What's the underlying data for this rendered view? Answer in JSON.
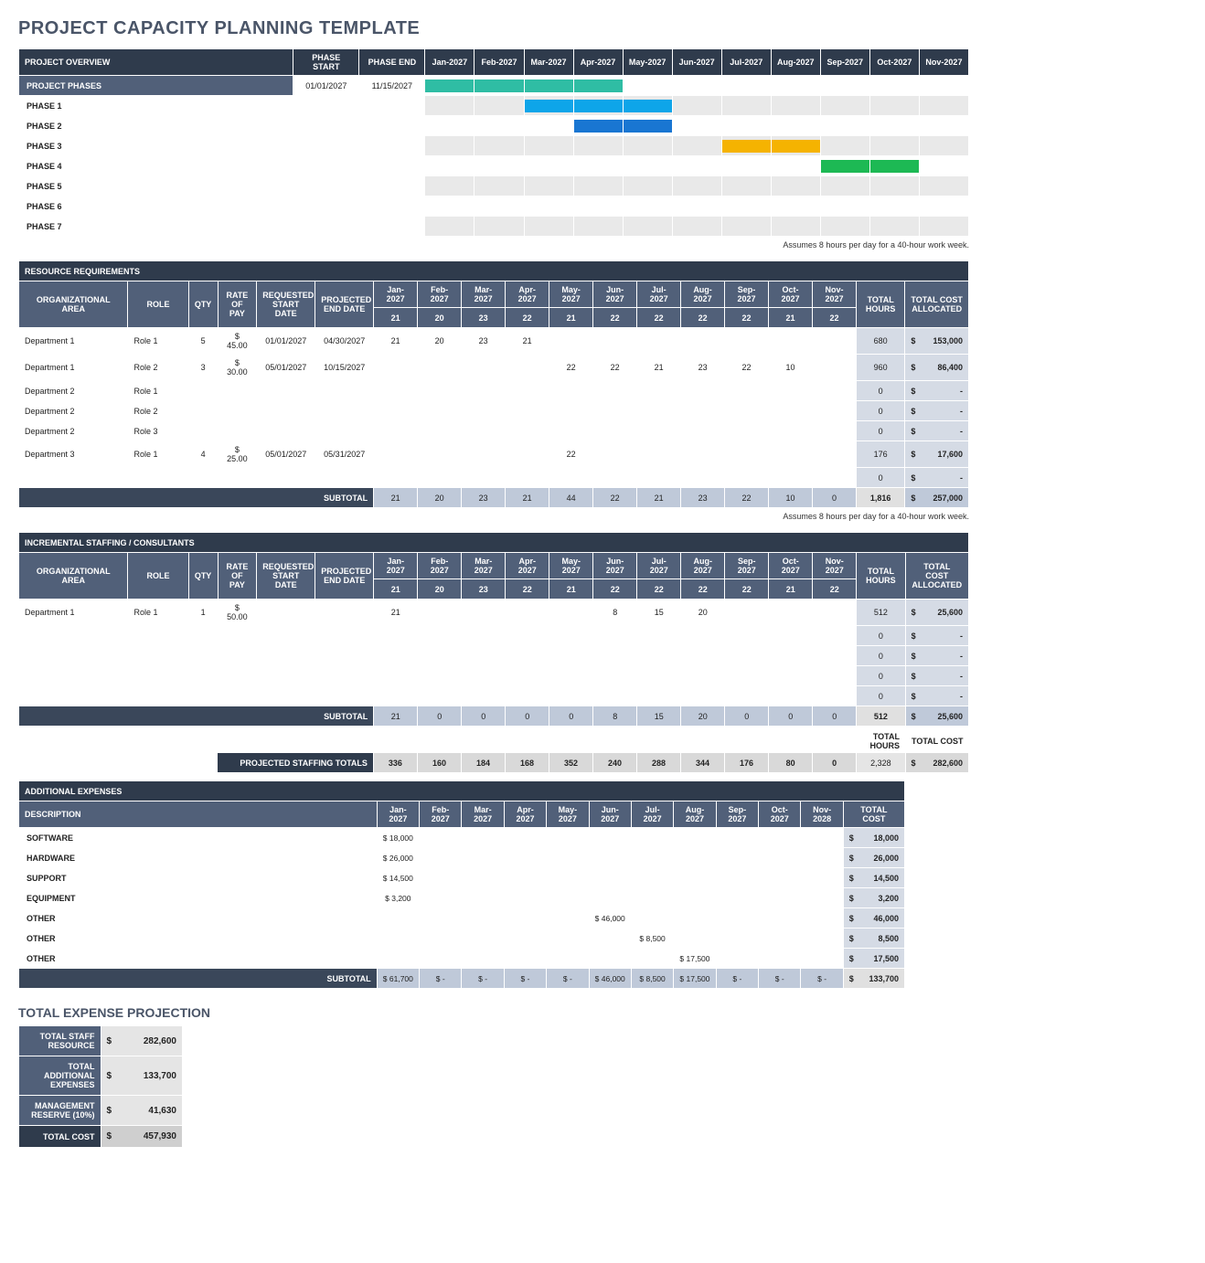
{
  "title": "PROJECT CAPACITY PLANNING TEMPLATE",
  "note": "Assumes 8 hours per day for a 40-hour work week.",
  "months": [
    "Jan-2027",
    "Feb-2027",
    "Mar-2027",
    "Apr-2027",
    "May-2027",
    "Jun-2027",
    "Jul-2027",
    "Aug-2027",
    "Sep-2027",
    "Oct-2027",
    "Nov-2027"
  ],
  "months_exp": [
    "Jan-2027",
    "Feb-2027",
    "Mar-2027",
    "Apr-2027",
    "May-2027",
    "Jun-2027",
    "Jul-2027",
    "Aug-2027",
    "Sep-2027",
    "Oct-2027",
    "Nov-2028"
  ],
  "overview": {
    "header": "PROJECT OVERVIEW",
    "phase_start": "PHASE START",
    "phase_end": "PHASE END",
    "rows": [
      {
        "label": "PROJECT PHASES",
        "start": "01/01/2027",
        "end": "11/15/2027",
        "fills": [
          "teal",
          "teal",
          "teal",
          "teal",
          "",
          "",
          "",
          "",
          "",
          "",
          ""
        ]
      },
      {
        "label": "PHASE 1",
        "start": "",
        "end": "",
        "fills": [
          "",
          "",
          "blue",
          "blue",
          "blue",
          "",
          "",
          "",
          "",
          "",
          ""
        ]
      },
      {
        "label": "PHASE 2",
        "start": "",
        "end": "",
        "fills": [
          "",
          "",
          "",
          "dblue",
          "dblue",
          "",
          "",
          "",
          "",
          "",
          ""
        ]
      },
      {
        "label": "PHASE 3",
        "start": "",
        "end": "",
        "fills": [
          "",
          "",
          "",
          "",
          "",
          "",
          "yellow",
          "yellow",
          "",
          "",
          ""
        ]
      },
      {
        "label": "PHASE 4",
        "start": "",
        "end": "",
        "fills": [
          "",
          "",
          "",
          "",
          "",
          "",
          "",
          "",
          "green",
          "green",
          ""
        ]
      },
      {
        "label": "PHASE 5",
        "start": "",
        "end": "",
        "fills": [
          "",
          "",
          "",
          "",
          "",
          "",
          "",
          "",
          "",
          "",
          ""
        ]
      },
      {
        "label": "PHASE 6",
        "start": "",
        "end": "",
        "fills": [
          "",
          "",
          "",
          "",
          "",
          "",
          "",
          "",
          "",
          "",
          ""
        ]
      },
      {
        "label": "PHASE 7",
        "start": "",
        "end": "",
        "fills": [
          "",
          "",
          "",
          "",
          "",
          "",
          "",
          "",
          "",
          "",
          ""
        ]
      }
    ]
  },
  "resource": {
    "header": "RESOURCE REQUIREMENTS",
    "cols": {
      "org": "ORGANIZATIONAL AREA",
      "role": "ROLE",
      "qty": "QTY",
      "rate": "RATE OF PAY",
      "req": "REQUESTED START DATE",
      "proj": "PROJECTED END DATE",
      "th": "TOTAL HOURS",
      "tc": "TOTAL COST ALLOCATED"
    },
    "month_sub": [
      "21",
      "20",
      "23",
      "22",
      "21",
      "22",
      "22",
      "22",
      "22",
      "21",
      "22"
    ],
    "rows": [
      {
        "org": "Department 1",
        "role": "Role 1",
        "qty": "5",
        "rate": "$ 45.00",
        "req": "01/01/2027",
        "proj": "04/30/2027",
        "m": [
          "21",
          "20",
          "23",
          "21",
          "",
          "",
          "",
          "",
          "",
          "",
          ""
        ],
        "th": "680",
        "tc": "153,000"
      },
      {
        "org": "Department 1",
        "role": "Role 2",
        "qty": "3",
        "rate": "$ 30.00",
        "req": "05/01/2027",
        "proj": "10/15/2027",
        "m": [
          "",
          "",
          "",
          "",
          "22",
          "22",
          "21",
          "23",
          "22",
          "10",
          ""
        ],
        "th": "960",
        "tc": "86,400"
      },
      {
        "org": "Department 2",
        "role": "Role 1",
        "qty": "",
        "rate": "",
        "req": "",
        "proj": "",
        "m": [
          "",
          "",
          "",
          "",
          "",
          "",
          "",
          "",
          "",
          "",
          ""
        ],
        "th": "0",
        "tc": "-"
      },
      {
        "org": "Department 2",
        "role": "Role 2",
        "qty": "",
        "rate": "",
        "req": "",
        "proj": "",
        "m": [
          "",
          "",
          "",
          "",
          "",
          "",
          "",
          "",
          "",
          "",
          ""
        ],
        "th": "0",
        "tc": "-"
      },
      {
        "org": "Department 2",
        "role": "Role 3",
        "qty": "",
        "rate": "",
        "req": "",
        "proj": "",
        "m": [
          "",
          "",
          "",
          "",
          "",
          "",
          "",
          "",
          "",
          "",
          ""
        ],
        "th": "0",
        "tc": "-"
      },
      {
        "org": "Department 3",
        "role": "Role 1",
        "qty": "4",
        "rate": "$ 25.00",
        "req": "05/01/2027",
        "proj": "05/31/2027",
        "m": [
          "",
          "",
          "",
          "",
          "22",
          "",
          "",
          "",
          "",
          "",
          ""
        ],
        "th": "176",
        "tc": "17,600"
      },
      {
        "org": "",
        "role": "",
        "qty": "",
        "rate": "",
        "req": "",
        "proj": "",
        "m": [
          "",
          "",
          "",
          "",
          "",
          "",
          "",
          "",
          "",
          "",
          ""
        ],
        "th": "0",
        "tc": "-"
      }
    ],
    "subtotal_label": "SUBTOTAL",
    "subtotal_m": [
      "21",
      "20",
      "23",
      "21",
      "44",
      "22",
      "21",
      "23",
      "22",
      "10",
      "0"
    ],
    "subtotal_th": "1,816",
    "subtotal_tc": "257,000"
  },
  "incremental": {
    "header": "INCREMENTAL STAFFING / CONSULTANTS",
    "month_sub": [
      "21",
      "20",
      "23",
      "22",
      "21",
      "22",
      "22",
      "22",
      "22",
      "21",
      "22"
    ],
    "rows": [
      {
        "org": "Department 1",
        "role": "Role 1",
        "qty": "1",
        "rate": "$ 50.00",
        "req": "",
        "proj": "",
        "m": [
          "21",
          "",
          "",
          "",
          "",
          "8",
          "15",
          "20",
          "",
          "",
          ""
        ],
        "th": "512",
        "tc": "25,600"
      },
      {
        "org": "",
        "role": "",
        "qty": "",
        "rate": "",
        "req": "",
        "proj": "",
        "m": [
          "",
          "",
          "",
          "",
          "",
          "",
          "",
          "",
          "",
          "",
          ""
        ],
        "th": "0",
        "tc": "-"
      },
      {
        "org": "",
        "role": "",
        "qty": "",
        "rate": "",
        "req": "",
        "proj": "",
        "m": [
          "",
          "",
          "",
          "",
          "",
          "",
          "",
          "",
          "",
          "",
          ""
        ],
        "th": "0",
        "tc": "-"
      },
      {
        "org": "",
        "role": "",
        "qty": "",
        "rate": "",
        "req": "",
        "proj": "",
        "m": [
          "",
          "",
          "",
          "",
          "",
          "",
          "",
          "",
          "",
          "",
          ""
        ],
        "th": "0",
        "tc": "-"
      },
      {
        "org": "",
        "role": "",
        "qty": "",
        "rate": "",
        "req": "",
        "proj": "",
        "m": [
          "",
          "",
          "",
          "",
          "",
          "",
          "",
          "",
          "",
          "",
          ""
        ],
        "th": "0",
        "tc": "-"
      }
    ],
    "subtotal_m": [
      "21",
      "0",
      "0",
      "0",
      "0",
      "8",
      "15",
      "20",
      "0",
      "0",
      "0"
    ],
    "subtotal_th": "512",
    "subtotal_tc": "25,600"
  },
  "projected_totals": {
    "label": "PROJECTED STAFFING TOTALS",
    "th_label": "TOTAL HOURS",
    "tc_label": "TOTAL COST",
    "m": [
      "336",
      "160",
      "184",
      "168",
      "352",
      "240",
      "288",
      "344",
      "176",
      "80",
      "0"
    ],
    "th": "2,328",
    "tc": "282,600"
  },
  "expenses": {
    "header": "ADDITIONAL EXPENSES",
    "desc": "DESCRIPTION",
    "tc": "TOTAL COST",
    "rows": [
      {
        "desc": "SOFTWARE",
        "m": [
          "$ 18,000",
          "",
          "",
          "",
          "",
          "",
          "",
          "",
          "",
          "",
          ""
        ],
        "tc": "18,000"
      },
      {
        "desc": "HARDWARE",
        "m": [
          "$ 26,000",
          "",
          "",
          "",
          "",
          "",
          "",
          "",
          "",
          "",
          ""
        ],
        "tc": "26,000"
      },
      {
        "desc": "SUPPORT",
        "m": [
          "$ 14,500",
          "",
          "",
          "",
          "",
          "",
          "",
          "",
          "",
          "",
          ""
        ],
        "tc": "14,500"
      },
      {
        "desc": "EQUIPMENT",
        "m": [
          "$   3,200",
          "",
          "",
          "",
          "",
          "",
          "",
          "",
          "",
          "",
          ""
        ],
        "tc": "3,200"
      },
      {
        "desc": "OTHER",
        "m": [
          "",
          "",
          "",
          "",
          "",
          "$ 46,000",
          "",
          "",
          "",
          "",
          ""
        ],
        "tc": "46,000"
      },
      {
        "desc": "OTHER",
        "m": [
          "",
          "",
          "",
          "",
          "",
          "",
          "$  8,500",
          "",
          "",
          "",
          ""
        ],
        "tc": "8,500"
      },
      {
        "desc": "OTHER",
        "m": [
          "",
          "",
          "",
          "",
          "",
          "",
          "",
          "$ 17,500",
          "",
          "",
          ""
        ],
        "tc": "17,500"
      }
    ],
    "subtotal_m": [
      "$ 61,700",
      "$      -",
      "$      -",
      "$      -",
      "$      -",
      "$ 46,000",
      "$  8,500",
      "$ 17,500",
      "$      -",
      "$      -",
      "$      -"
    ],
    "subtotal_tc": "133,700"
  },
  "projection": {
    "header": "TOTAL EXPENSE PROJECTION",
    "rows": [
      {
        "label": "TOTAL STAFF RESOURCE",
        "val": "282,600"
      },
      {
        "label": "TOTAL ADDITIONAL EXPENSES",
        "val": "133,700"
      },
      {
        "label": "MANAGEMENT RESERVE (10%)",
        "val": "41,630"
      },
      {
        "label": "TOTAL COST",
        "val": "457,930"
      }
    ]
  }
}
